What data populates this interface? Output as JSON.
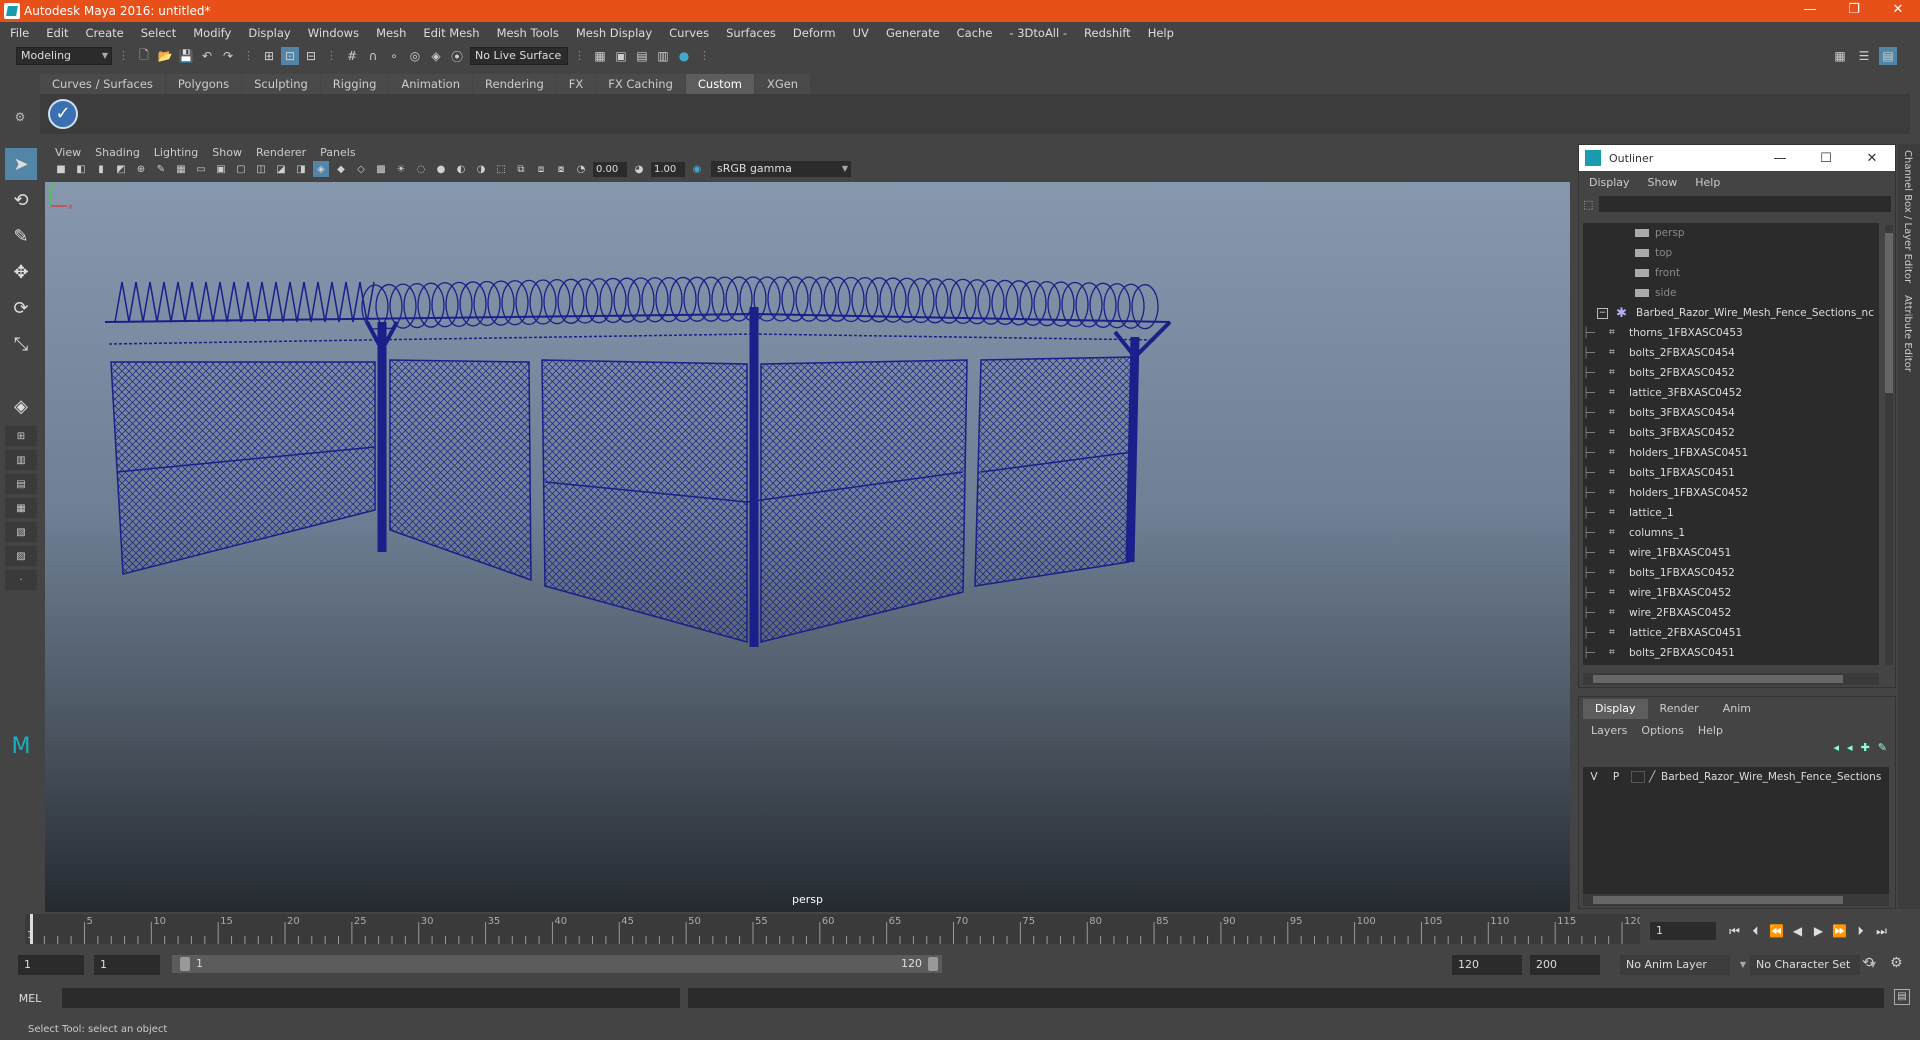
{
  "titlebar": {
    "title": "Autodesk Maya 2016: untitled*",
    "minimize": "—",
    "restore": "❐",
    "close": "✕"
  },
  "menubar": [
    "File",
    "Edit",
    "Create",
    "Select",
    "Modify",
    "Display",
    "Windows",
    "Mesh",
    "Edit Mesh",
    "Mesh Tools",
    "Mesh Display",
    "Curves",
    "Surfaces",
    "Deform",
    "UV",
    "Generate",
    "Cache",
    "- 3DtoAll -",
    "Redshift",
    "Help"
  ],
  "statusline": {
    "mode": "Modeling",
    "live_surface": "No Live Surface"
  },
  "shelf": {
    "tabs": [
      "Curves / Surfaces",
      "Polygons",
      "Sculpting",
      "Rigging",
      "Animation",
      "Rendering",
      "FX",
      "FX Caching",
      "Custom",
      "XGen"
    ],
    "active_tab": "Custom",
    "button_icon": "checkmark-icon"
  },
  "viewport": {
    "menu": [
      "View",
      "Shading",
      "Lighting",
      "Show",
      "Renderer",
      "Panels"
    ],
    "exposure": "0.00",
    "gamma": "1.00",
    "color_space": "sRGB gamma",
    "camera_label": "persp",
    "axis_y": "y",
    "axis_x": "x",
    "wire_color": "#1a1f8a"
  },
  "outliner": {
    "title": "Outliner",
    "menu": [
      "Display",
      "Show",
      "Help"
    ],
    "cameras": [
      "persp",
      "top",
      "front",
      "side"
    ],
    "group": "Barbed_Razor_Wire_Mesh_Fence_Sections_nc",
    "children": [
      "thorns_1FBXASC0453",
      "bolts_2FBXASC0454",
      "bolts_2FBXASC0452",
      "lattice_3FBXASC0452",
      "bolts_3FBXASC0454",
      "bolts_3FBXASC0452",
      "holders_1FBXASC0451",
      "bolts_1FBXASC0451",
      "holders_1FBXASC0452",
      "lattice_1",
      "columns_1",
      "wire_1FBXASC0451",
      "bolts_1FBXASC0452",
      "wire_1FBXASC0452",
      "wire_2FBXASC0452",
      "lattice_2FBXASC0451",
      "bolts_2FBXASC0451"
    ]
  },
  "layers": {
    "tabs": [
      "Display",
      "Render",
      "Anim"
    ],
    "active_tab": "Display",
    "menu": [
      "Layers",
      "Options",
      "Help"
    ],
    "row": {
      "v": "V",
      "p": "P",
      "name": "Barbed_Razor_Wire_Mesh_Fence_Sections"
    }
  },
  "sidetabs": [
    "Channel Box / Layer Editor",
    "Attribute Editor"
  ],
  "timeline": {
    "ticks": [
      5,
      10,
      15,
      20,
      25,
      30,
      35,
      40,
      45,
      50,
      55,
      60,
      65,
      70,
      75,
      80,
      85,
      90,
      95,
      100,
      105,
      110,
      115,
      120
    ],
    "start_label": "1",
    "current_frame": "1"
  },
  "range": {
    "start": "1",
    "range_start": "1",
    "slider_start": "1",
    "slider_end": "120",
    "range_end": "120",
    "end": "200",
    "anim_layer": "No Anim Layer",
    "character_set": "No Character Set"
  },
  "cmdline": {
    "label": "MEL"
  },
  "helpline": {
    "text": "Select Tool: select an object"
  }
}
